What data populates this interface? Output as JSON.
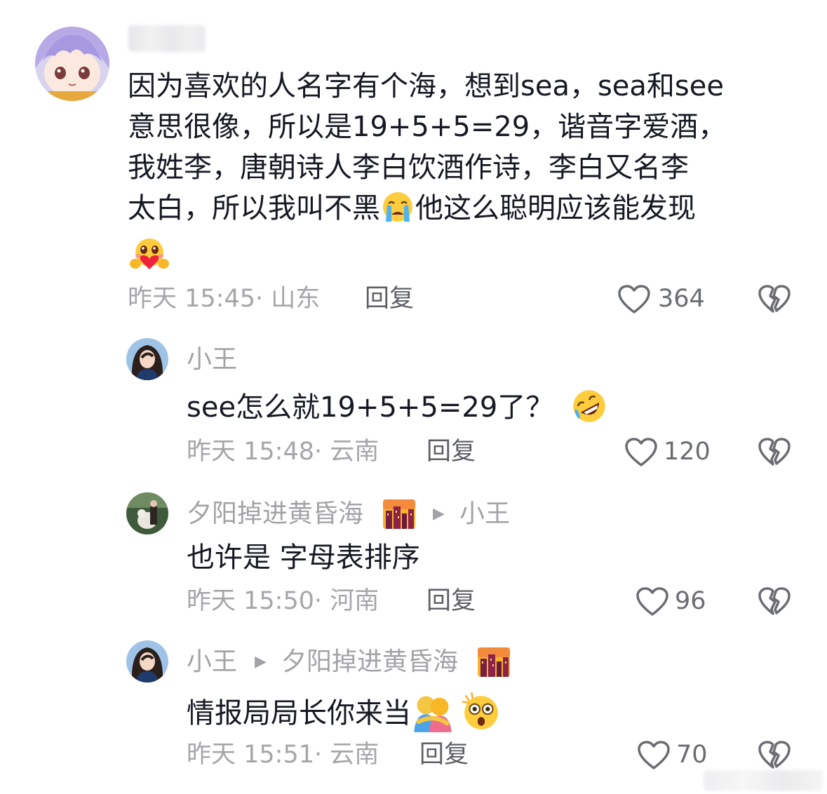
{
  "comments": [
    {
      "author": "",
      "lines": [
        "因为喜欢的人名字有个海，想到sea，sea和see",
        "意思很像，所以是19+5+5=29，谐音字爱酒，",
        "我姓李，唐朝诗人李白饮酒作诗，李白又名李",
        "太白，所以我叫不黑"
      ],
      "line4_suffix": "他这么聪明应该能发现",
      "meta": "昨天 15:45· 山东",
      "reply_label": "回复",
      "likes": "364"
    },
    {
      "author": "小王",
      "text": "see怎么就19+5+5=29了？",
      "meta": "昨天 15:48· 云南",
      "reply_label": "回复",
      "likes": "120"
    },
    {
      "author": "夕阳掉进黄昏海",
      "reply_to": "小王",
      "text": "也许是 字母表排序",
      "meta": "昨天 15:50· 河南",
      "reply_label": "回复",
      "likes": "96"
    },
    {
      "author": "小王",
      "reply_to": "夕阳掉进黄昏海",
      "text": "情报局局长你来当",
      "meta": "昨天 15:51· 云南",
      "reply_label": "回复",
      "likes": "70"
    }
  ],
  "icons": {
    "like": "heart-outline-icon",
    "dislike": "broken-heart-icon",
    "reply_arrow": "play-arrow-icon",
    "emoji_cry": "loudly-crying-face-emoji",
    "emoji_heart_hands": "face-holding-heart-emoji",
    "emoji_rofl": "rolling-on-floor-laughing-emoji",
    "emoji_city": "cityscape-dusk-emoji",
    "emoji_hug": "people-hugging-emoji",
    "emoji_dizzy": "astonished-face-emoji"
  },
  "colors": {
    "primary_text": "#161823",
    "secondary_text": "#a3a3a7",
    "icon_gray": "#6b6c72"
  }
}
